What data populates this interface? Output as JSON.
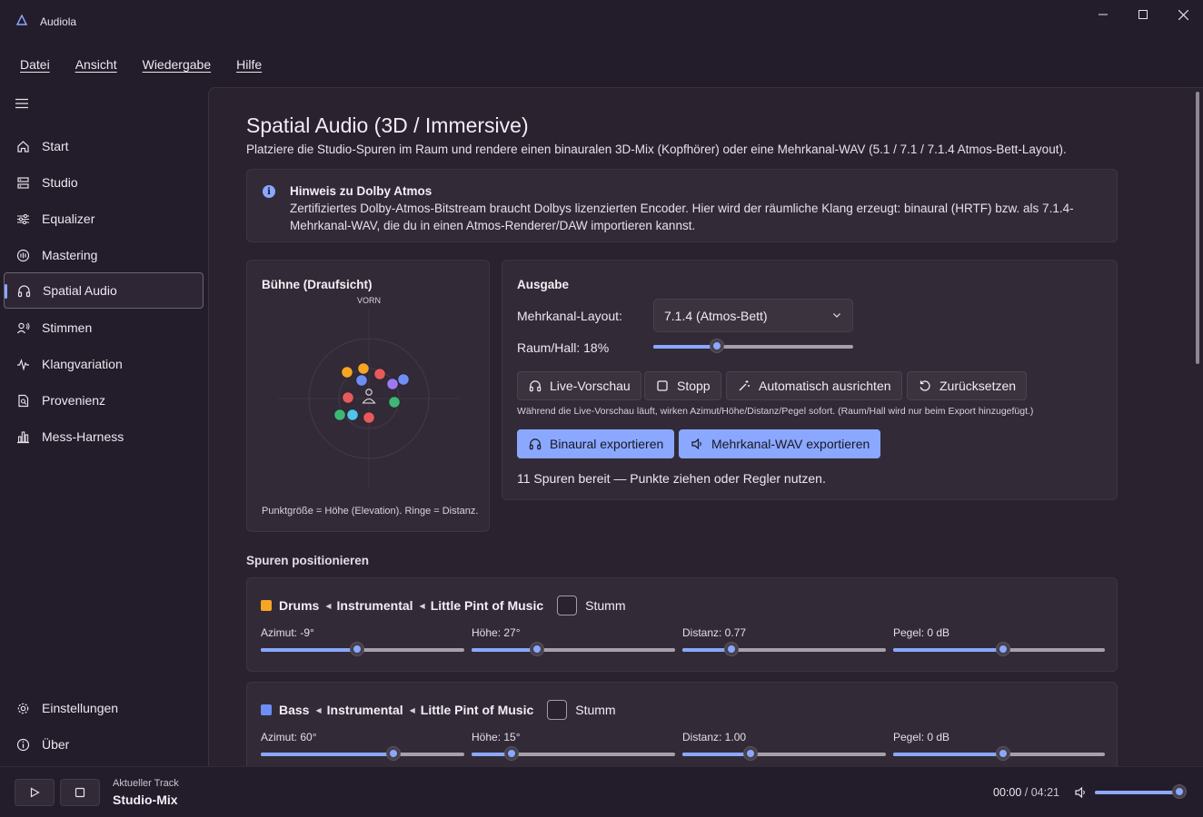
{
  "app": {
    "title": "Audiola"
  },
  "menu": [
    "Datei",
    "Ansicht",
    "Wiedergabe",
    "Hilfe"
  ],
  "nav": {
    "items": [
      {
        "label": "Start",
        "icon": "home-icon"
      },
      {
        "label": "Studio",
        "icon": "studio-icon"
      },
      {
        "label": "Equalizer",
        "icon": "equalizer-icon"
      },
      {
        "label": "Mastering",
        "icon": "mastering-icon"
      },
      {
        "label": "Spatial Audio",
        "icon": "headphones-icon"
      },
      {
        "label": "Stimmen",
        "icon": "voices-icon"
      },
      {
        "label": "Klangvariation",
        "icon": "waveform-icon"
      },
      {
        "label": "Provenienz",
        "icon": "provenance-icon"
      },
      {
        "label": "Mess-Harness",
        "icon": "chart-icon"
      }
    ],
    "active": "Spatial Audio",
    "footer": [
      {
        "label": "Einstellungen",
        "icon": "gear-icon"
      },
      {
        "label": "Über",
        "icon": "info-icon"
      }
    ]
  },
  "page": {
    "title": "Spatial Audio (3D / Immersive)",
    "description": "Platziere die Studio-Spuren im Raum und rendere einen binauralen 3D-Mix (Kopfhörer) oder eine Mehrkanal-WAV (5.1 / 7.1 / 7.1.4 Atmos-Bett-Layout)."
  },
  "info": {
    "title": "Hinweis zu Dolby Atmos",
    "text": "Zertifiziertes Dolby-Atmos-Bitstream braucht Dolbys lizenzierten Encoder. Hier wird der räumliche Klang erzeugt: binaural (HRTF) bzw. als 7.1.4-Mehrkanal-WAV, die du in einen Atmos-Renderer/DAW importieren kannst."
  },
  "stage": {
    "title": "Bühne (Draufsicht)",
    "front_label": "VORN",
    "caption": "Punktgröße = Höhe (Elevation). Ringe = Distanz.",
    "dots": [
      {
        "color": "#f5a623"
      },
      {
        "color": "#f5a623"
      },
      {
        "color": "#6d8ef5"
      },
      {
        "color": "#e85a5a"
      },
      {
        "color": "#9b7af0"
      },
      {
        "color": "#6d8ef5"
      },
      {
        "color": "#e85a5a"
      },
      {
        "color": "#3db874"
      },
      {
        "color": "#3db874"
      },
      {
        "color": "#4fc3e8"
      },
      {
        "color": "#e85a5a"
      }
    ]
  },
  "output": {
    "title": "Ausgabe",
    "layout_label": "Mehrkanal-Layout:",
    "layout_value": "7.1.4 (Atmos-Bett)",
    "reverb_label": "Raum/Hall: 18%",
    "reverb_value": 18,
    "buttons": {
      "preview": "Live-Vorschau",
      "stop": "Stopp",
      "auto": "Automatisch ausrichten",
      "reset": "Zurücksetzen"
    },
    "hint": "Während die Live-Vorschau läuft, wirken Azimut/Höhe/Distanz/Pegel sofort. (Raum/Hall wird nur beim Export hinzugefügt.)",
    "export_binaural": "Binaural exportieren",
    "export_multichannel": "Mehrkanal-WAV exportieren",
    "status": "11 Spuren bereit — Punkte ziehen oder Regler nutzen."
  },
  "tracks_section": "Spuren positionieren",
  "tracks": [
    {
      "name": "Drums",
      "group": "Instrumental",
      "song": "Little Pint of Music",
      "color": "#f5a623",
      "mute_label": "Stumm",
      "azimut_label": "Azimut: -9°",
      "azimut_pos": 0.475,
      "hoehe_label": "Höhe: 27°",
      "hoehe_pos": 0.32,
      "distanz_label": "Distanz: 0.77",
      "distanz_pos": 0.24,
      "pegel_label": "Pegel: 0 dB",
      "pegel_pos": 0.52
    },
    {
      "name": "Bass",
      "group": "Instrumental",
      "song": "Little Pint of Music",
      "color": "#6d8ef5",
      "mute_label": "Stumm",
      "azimut_label": "Azimut: 60°",
      "azimut_pos": 0.65,
      "hoehe_label": "Höhe: 15°",
      "hoehe_pos": 0.195,
      "distanz_label": "Distanz: 1.00",
      "distanz_pos": 0.335,
      "pegel_label": "Pegel: 0 dB",
      "pegel_pos": 0.52
    }
  ],
  "player": {
    "now_label": "Aktueller Track",
    "now_title": "Studio-Mix",
    "current_time": "00:00",
    "separator": " / ",
    "duration": "04:21",
    "volume": 1.0
  }
}
